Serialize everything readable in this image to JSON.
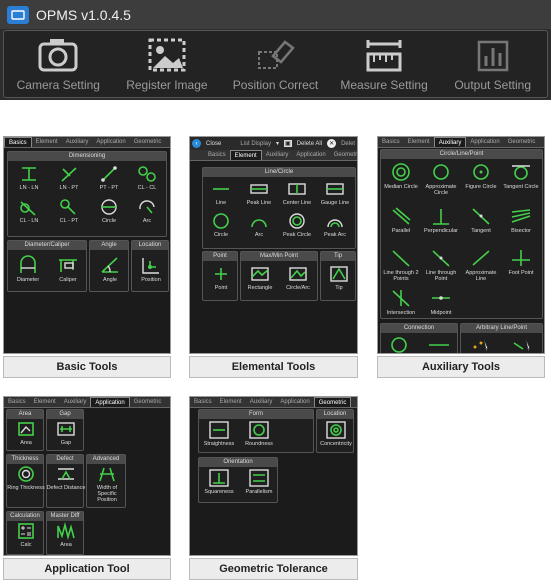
{
  "app": {
    "title": "OPMS v1.0.4.5",
    "buttons": [
      {
        "label": "Camera Setting",
        "icon": "camera-icon"
      },
      {
        "label": "Register Image",
        "icon": "image-icon"
      },
      {
        "label": "Position Correct",
        "icon": "eraser-icon"
      },
      {
        "label": "Measure Setting",
        "icon": "ruler-icon"
      },
      {
        "label": "Output Setting",
        "icon": "chart-icon"
      }
    ]
  },
  "panels": {
    "basic": {
      "caption": "Basic Tools",
      "tabs": [
        "Basics",
        "Element",
        "Auxiliary",
        "Application",
        "Geometric"
      ],
      "dimensioning": "Dimensioning",
      "items": [
        "LN - LN",
        "LN - PT",
        "PT - PT",
        "CL - CL",
        "CL - LN",
        "CL - PT",
        "Circle",
        "Arc"
      ],
      "groups": [
        "Diameter/Caliper",
        "Angle",
        "Location"
      ],
      "items2": [
        "Diameter",
        "Caliper",
        "Angle",
        "Position"
      ]
    },
    "elemental": {
      "caption": "Elemental Tools",
      "top": {
        "close": "Close",
        "list": "List Display",
        "delete": "Delete All",
        "more": "Delet"
      },
      "tabs": [
        "Basics",
        "Element",
        "Auxiliary",
        "Application",
        "Geometri"
      ],
      "linecircle": "Line/Circle",
      "items": [
        "Line",
        "Peak Line",
        "Center Line",
        "Gauge Line",
        "Circle",
        "Arc",
        "Peak Circle",
        "Peak Arc"
      ],
      "groups": [
        "Point",
        "Max/Min Point",
        "Tip"
      ],
      "items2": [
        "Point",
        "Rectangle",
        "Circle/Arc",
        "Tip"
      ]
    },
    "auxiliary": {
      "caption": "Auxiliary Tools",
      "tabs": [
        "Basics",
        "Element",
        "Auxiliary",
        "Application",
        "Geometric"
      ],
      "clp": "Circle/Line/Point",
      "items": [
        "Median Circle",
        "Approximate Circle",
        "Figure Circle",
        "Tangent Circle",
        "Parallel",
        "Perpendicular",
        "Tangent",
        "Bisector",
        "Line through 2 Points",
        "Line through Point",
        "Approximate Line",
        "Foot Point",
        "Intersection",
        "Midpoint"
      ],
      "groups": [
        "Connection",
        "Arbitrary Line/Point"
      ]
    },
    "application": {
      "caption": "Application Tool",
      "tabs": [
        "Basics",
        "Element",
        "Auxiliary",
        "Application",
        "Geometric"
      ],
      "groups": [
        "Area",
        "Gap",
        "Thickness",
        "Defect",
        "Advanced",
        "Calculation",
        "Master Diff"
      ],
      "items": [
        "Area",
        "Gap",
        "Ring Thickness",
        "Defect Distance",
        "Width of Specific Position",
        "Calc",
        "Area"
      ]
    },
    "geometric": {
      "caption": "Geometric Tolerance",
      "tabs": [
        "Basics",
        "Element",
        "Auxiliary",
        "Application",
        "Geometric"
      ],
      "groups": [
        "Form",
        "Location",
        "Orientation"
      ],
      "items": [
        "Straightness",
        "Roundness",
        "Concentricity",
        "Squareness",
        "Parallelism"
      ]
    }
  }
}
